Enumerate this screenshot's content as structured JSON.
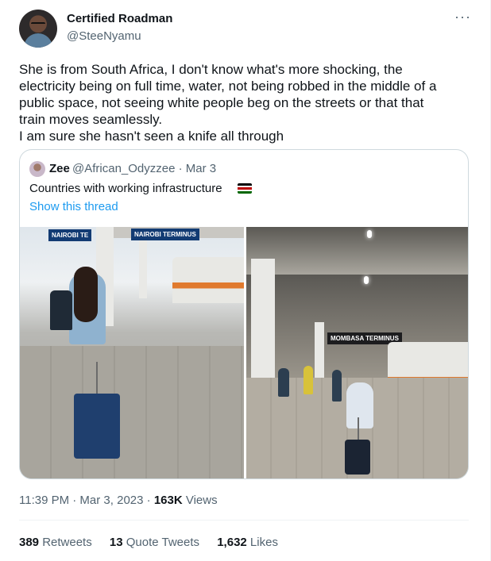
{
  "tweet": {
    "display_name": "Certified Roadman",
    "handle": "@SteeNyamu",
    "more_icon": "more-horizontal-icon",
    "text": "She is from South Africa, I don't know what's more shocking, the\nelectricity being on full time, water, not being robbed in the middle of a\npublic space, not seeing white people beg on the streets or that that\ntrain moves seamlessly.\nI am sure she hasn't seen a knife all through",
    "time": "11:39 PM · Mar 3, 2023 · ",
    "views_count": "163K",
    "views_label": " Views"
  },
  "quote": {
    "display_name": "Zee",
    "handle": "@African_Odyzzee · Mar 3",
    "text": "Countries with working infrastructure",
    "flag_icon": "kenya-flag-icon",
    "show_thread": "Show this thread",
    "photo_left_sign_1": "NAIROBI TE",
    "photo_left_sign_2": "NAIROBI TERMINUS",
    "photo_right_sign": "MOMBASA TERMINUS"
  },
  "stats": {
    "retweets_count": "389",
    "retweets_label": " Retweets",
    "quotes_count": "13",
    "quotes_label": " Quote Tweets",
    "likes_count": "1,632",
    "likes_label": " Likes"
  },
  "colors": {
    "link": "#1d9bf0",
    "secondary_text": "#536471",
    "primary_text": "#0f1419",
    "border": "#cfd9de"
  }
}
